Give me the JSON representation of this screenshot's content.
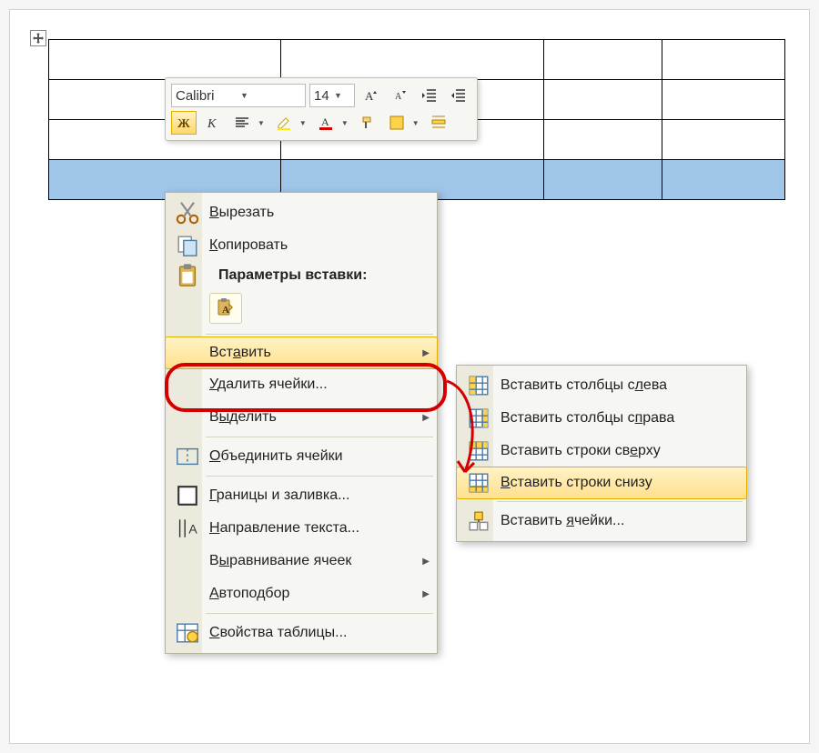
{
  "toolbar": {
    "font_name": "Calibri",
    "font_size": "14"
  },
  "context_menu": {
    "cut": "Вырезать",
    "copy": "Копировать",
    "paste_options_label": "Параметры вставки:",
    "insert": "Вставить",
    "delete_cells": "Удалить ячейки...",
    "select": "Выделить",
    "merge_cells": "Объединить ячейки",
    "borders_shading": "Границы и заливка...",
    "text_direction": "Направление текста...",
    "cell_alignment": "Выравнивание ячеек",
    "autofit": "Автоподбор",
    "table_properties": "Свойства таблицы..."
  },
  "insert_submenu": {
    "cols_left": "Вставить столбцы слева",
    "cols_right": "Вставить столбцы справа",
    "rows_above": "Вставить строки сверху",
    "rows_below": "Вставить строки снизу",
    "cells": "Вставить ячейки..."
  }
}
